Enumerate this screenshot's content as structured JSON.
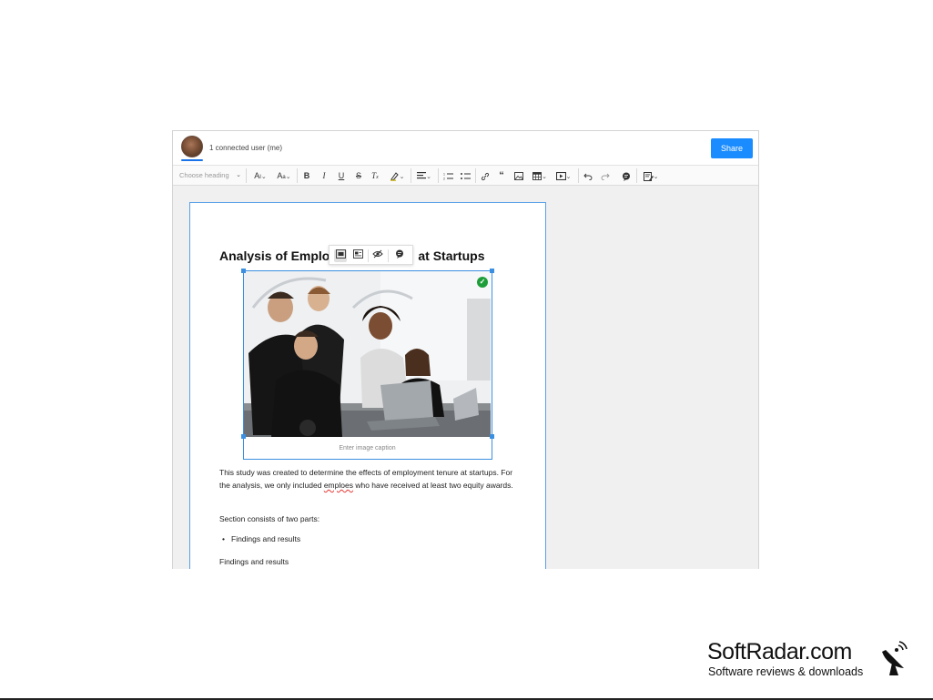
{
  "presence": {
    "users_text": "1 connected user (me)",
    "share_label": "Share"
  },
  "toolbar": {
    "heading_placeholder": "Choose heading",
    "items": [
      "font-size",
      "font-family",
      "bold",
      "italic",
      "underline",
      "strikethrough",
      "remove-format",
      "highlight",
      "alignment",
      "numbered-list",
      "bulleted-list",
      "link",
      "blockquote",
      "insert-image",
      "insert-table",
      "insert-media",
      "undo",
      "redo",
      "comment",
      "track-changes"
    ]
  },
  "document": {
    "title_left": "Analysis of Emplo",
    "title_right": "at Startups",
    "caption_placeholder": "Enter image caption",
    "paragraph1_a": "This study was created to determine the effects of employment tenure at startups. For the analysis, we only included ",
    "paragraph1_misspelled": "emploes",
    "paragraph1_b": " who have received at least two equity awards.",
    "paragraph2": "Section consists of two parts:",
    "bullet1": "Findings and results",
    "paragraph3": "Findings and results"
  },
  "image_toolbar": {
    "items": [
      "image-inline",
      "image-block",
      "toggle-alt-text",
      "comment"
    ]
  },
  "watermark": {
    "name": "SoftRadar.com",
    "tagline": "Software reviews & downloads"
  },
  "colors": {
    "accent": "#1a8cff",
    "selection": "#3b8fe0",
    "check": "#1e9e3a"
  }
}
